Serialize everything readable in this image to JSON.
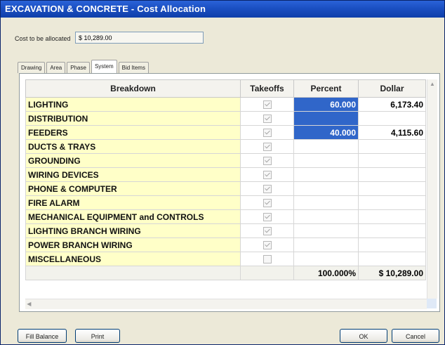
{
  "window": {
    "title": "EXCAVATION & CONCRETE - Cost Allocation"
  },
  "cost": {
    "label": "Cost to be allocated",
    "value": "$ 10,289.00"
  },
  "tabs": [
    {
      "label": "Drawing"
    },
    {
      "label": "Area"
    },
    {
      "label": "Phase"
    },
    {
      "label": "System",
      "active": true
    },
    {
      "label": "Bid Items"
    }
  ],
  "grid": {
    "headers": {
      "breakdown": "Breakdown",
      "takeoffs": "Takeoffs",
      "percent": "Percent",
      "dollar": "Dollar"
    },
    "rows": [
      {
        "breakdown": "LIGHTING",
        "takeoff": true,
        "percent": "60.000",
        "dollar": "6,173.40",
        "selected": true
      },
      {
        "breakdown": "DISTRIBUTION",
        "takeoff": true,
        "percent": "",
        "dollar": "",
        "selected": true
      },
      {
        "breakdown": "FEEDERS",
        "takeoff": true,
        "percent": "40.000",
        "dollar": "4,115.60",
        "selected": true
      },
      {
        "breakdown": "DUCTS & TRAYS",
        "takeoff": true,
        "percent": "",
        "dollar": ""
      },
      {
        "breakdown": "GROUNDING",
        "takeoff": true,
        "percent": "",
        "dollar": ""
      },
      {
        "breakdown": "WIRING DEVICES",
        "takeoff": true,
        "percent": "",
        "dollar": ""
      },
      {
        "breakdown": "PHONE & COMPUTER",
        "takeoff": true,
        "percent": "",
        "dollar": ""
      },
      {
        "breakdown": "FIRE ALARM",
        "takeoff": true,
        "percent": "",
        "dollar": ""
      },
      {
        "breakdown": "MECHANICAL EQUIPMENT and CONTROLS",
        "takeoff": true,
        "percent": "",
        "dollar": ""
      },
      {
        "breakdown": "LIGHTING BRANCH WIRING",
        "takeoff": true,
        "percent": "",
        "dollar": ""
      },
      {
        "breakdown": "POWER BRANCH WIRING",
        "takeoff": true,
        "percent": "",
        "dollar": ""
      },
      {
        "breakdown": "MISCELLANEOUS",
        "takeoff": false,
        "percent": "",
        "dollar": ""
      }
    ],
    "totals": {
      "percent": "100.000%",
      "dollar": "$ 10,289.00"
    }
  },
  "buttons": {
    "fill_balance": "Fill Balance",
    "print": "Print",
    "ok": "OK",
    "cancel": "Cancel"
  },
  "colors": {
    "title_bar": "#1b4fc2",
    "breakdown_cell": "#ffffc8",
    "selected_cell": "#3066c9"
  }
}
